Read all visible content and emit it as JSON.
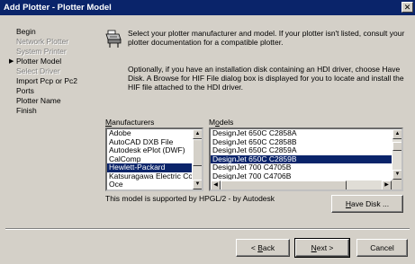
{
  "window": {
    "title": "Add Plotter - Plotter Model",
    "close_glyph": "✕"
  },
  "steps": [
    {
      "label": "Begin",
      "state": "normal"
    },
    {
      "label": "Network Plotter",
      "state": "disabled"
    },
    {
      "label": "System Printer",
      "state": "disabled"
    },
    {
      "label": "Plotter Model",
      "state": "current"
    },
    {
      "label": "Select Driver",
      "state": "disabled"
    },
    {
      "label": "Import Pcp or Pc2",
      "state": "normal"
    },
    {
      "label": "Ports",
      "state": "normal"
    },
    {
      "label": "Plotter Name",
      "state": "normal"
    },
    {
      "label": "Finish",
      "state": "normal"
    }
  ],
  "intro_text": "Select your plotter manufacturer and model. If your plotter isn't listed, consult your plotter documentation for a compatible plotter.",
  "note_text": "Optionally, if you have an installation disk containing an HDI driver, choose Have Disk. A Browse for HIF File dialog box is displayed for you to locate and install the HIF file attached to the HDI driver.",
  "manufacturers": {
    "label_prefix": "",
    "label_hotkey": "M",
    "label_rest": "anufacturers",
    "items": [
      "Adobe",
      "AutoCAD DXB File",
      "Autodesk ePlot (DWF)",
      "CalComp",
      "Hewlett-Packard",
      "Katsuragawa Electric Co",
      "Oce"
    ],
    "selected": 4
  },
  "models": {
    "label_prefix": "M",
    "label_hotkey": "o",
    "label_rest": "dels",
    "items": [
      "DesignJet 650C C2858A",
      "DesignJet 650C C2858B",
      "DesignJet 650C C2859A",
      "DesignJet 650C C2859B",
      "DesignJet 700 C4705B",
      "DesignJet 700 C4706B"
    ],
    "selected": 3
  },
  "support_text": "This model is supported by HPGL/2 - by Autodesk",
  "buttons": {
    "have_disk": {
      "prefix": "",
      "hotkey": "H",
      "rest": "ave Disk ..."
    },
    "back": {
      "prefix": "< ",
      "hotkey": "B",
      "rest": "ack"
    },
    "next": {
      "prefix": "",
      "hotkey": "N",
      "rest": "ext >"
    },
    "cancel": "Cancel"
  },
  "icons": {
    "current_step": "current-step-arrow-icon",
    "wizard": "plotter-wizard-icon",
    "scroll_up": "scroll-up-icon",
    "scroll_down": "scroll-down-icon",
    "scroll_left": "scroll-left-icon",
    "scroll_right": "scroll-right-icon"
  },
  "colors": {
    "titlebar": "#0a246a",
    "dialog": "#d4d0c8",
    "selection": "#0a246a"
  }
}
